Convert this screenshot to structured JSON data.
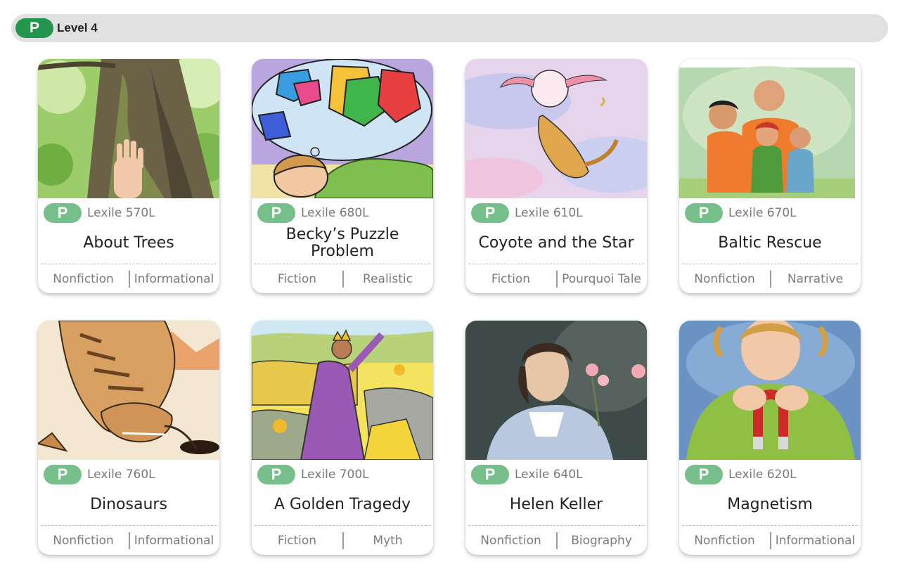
{
  "level": {
    "badge": "P",
    "label": "Level 4"
  },
  "colors": {
    "level_badge": "#22964f",
    "card_badge": "#76bf8a"
  },
  "books": [
    {
      "badge": "P",
      "lexile": "Lexile 570L",
      "title": "About Trees",
      "genre": "Nonfiction",
      "type": "Informational"
    },
    {
      "badge": "P",
      "lexile": "Lexile 680L",
      "title": "Becky’s Puzzle Problem",
      "genre": "Fiction",
      "type": "Realistic"
    },
    {
      "badge": "P",
      "lexile": "Lexile 610L",
      "title": "Coyote and the Star",
      "genre": "Fiction",
      "type": "Pourquoi Tale"
    },
    {
      "badge": "P",
      "lexile": "Lexile 670L",
      "title": "Baltic Rescue",
      "genre": "Nonfiction",
      "type": "Narrative"
    },
    {
      "badge": "P",
      "lexile": "Lexile 760L",
      "title": "Dinosaurs",
      "genre": "Nonfiction",
      "type": "Informational"
    },
    {
      "badge": "P",
      "lexile": "Lexile 700L",
      "title": "A Golden Tragedy",
      "genre": "Fiction",
      "type": "Myth"
    },
    {
      "badge": "P",
      "lexile": "Lexile 640L",
      "title": "Helen Keller",
      "genre": "Nonfiction",
      "type": "Biography"
    },
    {
      "badge": "P",
      "lexile": "Lexile 620L",
      "title": "Magnetism",
      "genre": "Nonfiction",
      "type": "Informational"
    }
  ]
}
